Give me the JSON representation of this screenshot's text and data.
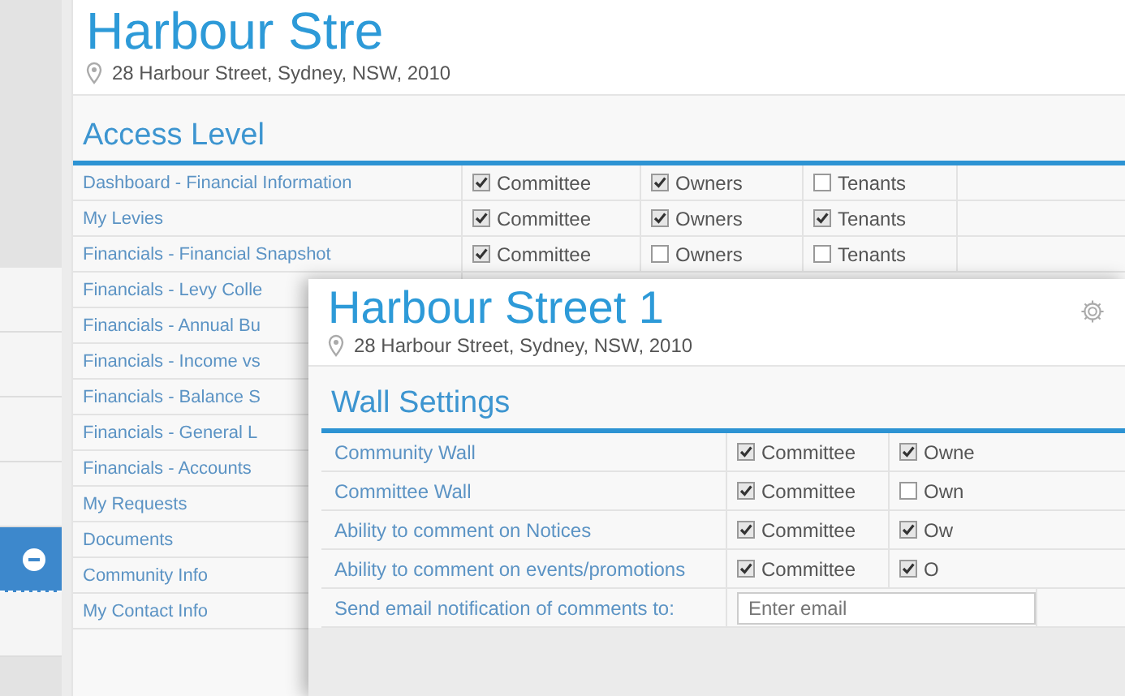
{
  "back_panel": {
    "title": "Harbour Stre",
    "address": "28 Harbour Street, Sydney, NSW, 2010",
    "sidebar": {
      "items": [
        {
          "selected": false
        },
        {
          "selected": false
        },
        {
          "selected": false
        },
        {
          "selected": false
        },
        {
          "selected": true
        },
        {
          "selected": false
        }
      ]
    },
    "section": "Access Level",
    "rows": [
      {
        "label": "Dashboard - Financial Information",
        "permissions": [
          {
            "label": "Committee",
            "checked": true
          },
          {
            "label": "Owners",
            "checked": true
          },
          {
            "label": "Tenants",
            "checked": false
          }
        ]
      },
      {
        "label": "My Levies",
        "permissions": [
          {
            "label": "Committee",
            "checked": true
          },
          {
            "label": "Owners",
            "checked": true
          },
          {
            "label": "Tenants",
            "checked": true
          }
        ]
      },
      {
        "label": "Financials - Financial Snapshot",
        "permissions": [
          {
            "label": "Committee",
            "checked": true
          },
          {
            "label": "Owners",
            "checked": false
          },
          {
            "label": "Tenants",
            "checked": false
          }
        ]
      },
      {
        "label": "Financials - Levy Colle"
      },
      {
        "label": "Financials - Annual Bu"
      },
      {
        "label": "Financials - Income vs"
      },
      {
        "label": "Financials - Balance S"
      },
      {
        "label": "Financials - General L"
      },
      {
        "label": "Financials - Accounts"
      },
      {
        "label": "My Requests"
      },
      {
        "label": "Documents"
      },
      {
        "label": "Community Info"
      },
      {
        "label": "My Contact Info"
      }
    ]
  },
  "front_panel": {
    "title": "Harbour Street 1",
    "address": "28 Harbour Street, Sydney, NSW, 2010",
    "section": "Wall Settings",
    "rows": [
      {
        "kind": "checks",
        "label": "Community Wall",
        "permissions": [
          {
            "label": "Committee",
            "checked": true
          },
          {
            "label": "Owne",
            "checked": true
          }
        ]
      },
      {
        "kind": "checks",
        "label": "Committee Wall",
        "permissions": [
          {
            "label": "Committee",
            "checked": true
          },
          {
            "label": "Own",
            "checked": false
          }
        ]
      },
      {
        "kind": "checks",
        "label": "Ability to comment on Notices",
        "permissions": [
          {
            "label": "Committee",
            "checked": true
          },
          {
            "label": "Ow",
            "checked": true
          }
        ]
      },
      {
        "kind": "checks",
        "label": "Ability to comment on events/promotions",
        "permissions": [
          {
            "label": "Committee",
            "checked": true
          },
          {
            "label": "O",
            "checked": true
          }
        ]
      },
      {
        "kind": "email",
        "label": "Send email notification of comments to:",
        "placeholder": "Enter email"
      }
    ]
  }
}
